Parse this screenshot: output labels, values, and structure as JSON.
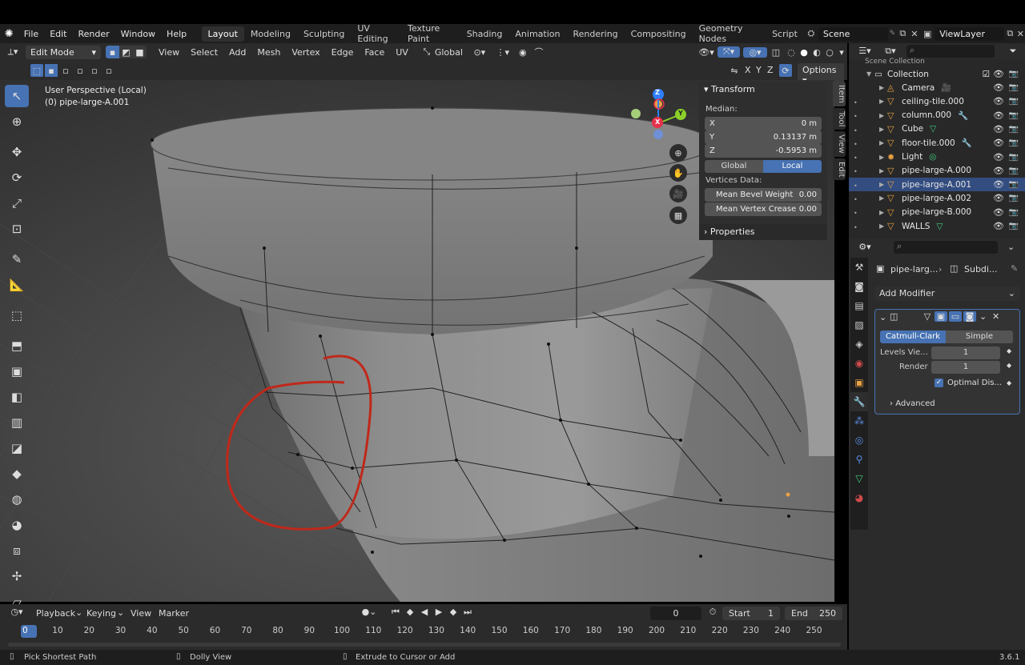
{
  "menubar": {
    "items": [
      "File",
      "Edit",
      "Render",
      "Window",
      "Help"
    ],
    "workspaces": [
      "Layout",
      "Modeling",
      "Sculpting",
      "UV Editing",
      "Texture Paint",
      "Shading",
      "Animation",
      "Rendering",
      "Compositing",
      "Geometry Nodes",
      "Script"
    ],
    "active_workspace": "Layout",
    "scene": "Scene",
    "view_layer": "ViewLayer"
  },
  "viewport_header": {
    "mode": "Edit Mode",
    "menus": [
      "View",
      "Select",
      "Add",
      "Mesh",
      "Vertex",
      "Edge",
      "Face",
      "UV"
    ],
    "orientation": "Global",
    "axes": [
      "X",
      "Y",
      "Z"
    ],
    "options": "Options"
  },
  "viewport": {
    "perspective": "User Perspective (Local)",
    "object": "(0) pipe-large-A.001",
    "gizmo": {
      "x": "X",
      "y": "Y",
      "z": "Z"
    }
  },
  "npanel": {
    "transform_title": "Transform",
    "median_label": "Median:",
    "x_label": "X",
    "x_value": "0 m",
    "y_label": "Y",
    "y_value": "0.13137 m",
    "z_label": "Z",
    "z_value": "-0.5953 m",
    "global": "Global",
    "local": "Local",
    "vertices_data": "Vertices Data:",
    "bevel_label": "Mean Bevel Weight",
    "bevel_value": "0.00",
    "crease_label": "Mean Vertex Crease",
    "crease_value": "0.00",
    "properties_title": "Properties",
    "tabs": [
      "Item",
      "Tool",
      "View",
      "Edit"
    ]
  },
  "outliner": {
    "scene_collection": "Scene Collection",
    "collection": "Collection",
    "items": [
      {
        "name": "Camera",
        "icon": "camera-icon"
      },
      {
        "name": "ceiling-tile.000",
        "icon": "mesh-icon"
      },
      {
        "name": "column.000",
        "icon": "mesh-icon"
      },
      {
        "name": "Cube",
        "icon": "mesh-icon"
      },
      {
        "name": "floor-tile.000",
        "icon": "mesh-icon"
      },
      {
        "name": "Light",
        "icon": "light-icon"
      },
      {
        "name": "pipe-large-A.000",
        "icon": "mesh-icon"
      },
      {
        "name": "pipe-large-A.001",
        "icon": "mesh-icon"
      },
      {
        "name": "pipe-large-A.002",
        "icon": "mesh-icon"
      },
      {
        "name": "pipe-large-B.000",
        "icon": "mesh-icon"
      },
      {
        "name": "WALLS",
        "icon": "mesh-icon"
      }
    ]
  },
  "properties": {
    "breadcrumb_object": "pipe-larg...",
    "breadcrumb_modifier": "Subdi...",
    "add_modifier": "Add Modifier",
    "catmull": "Catmull-Clark",
    "simple": "Simple",
    "levels_label": "Levels Vie...",
    "levels_value": "1",
    "render_label": "Render",
    "render_value": "1",
    "optimal": "Optimal Dis...",
    "advanced": "Advanced"
  },
  "timeline": {
    "menus": [
      "Playback",
      "Keying",
      "View",
      "Marker"
    ],
    "current_frame": "0",
    "start_label": "Start",
    "start_value": "1",
    "end_label": "End",
    "end_value": "250",
    "ticks": [
      "0",
      "10",
      "20",
      "30",
      "40",
      "50",
      "60",
      "70",
      "80",
      "90",
      "100",
      "110",
      "120",
      "130",
      "140",
      "150",
      "160",
      "170",
      "180",
      "190",
      "200",
      "210",
      "220",
      "230",
      "240",
      "250"
    ]
  },
  "statusbar": {
    "hint1": "Pick Shortest Path",
    "hint2": "Dolly View",
    "hint3": "Extrude to Cursor or Add",
    "version": "3.6.1"
  },
  "colors": {
    "accent": "#4772b3",
    "annotation": "#c0281a",
    "mesh": "#a8a8a8"
  }
}
